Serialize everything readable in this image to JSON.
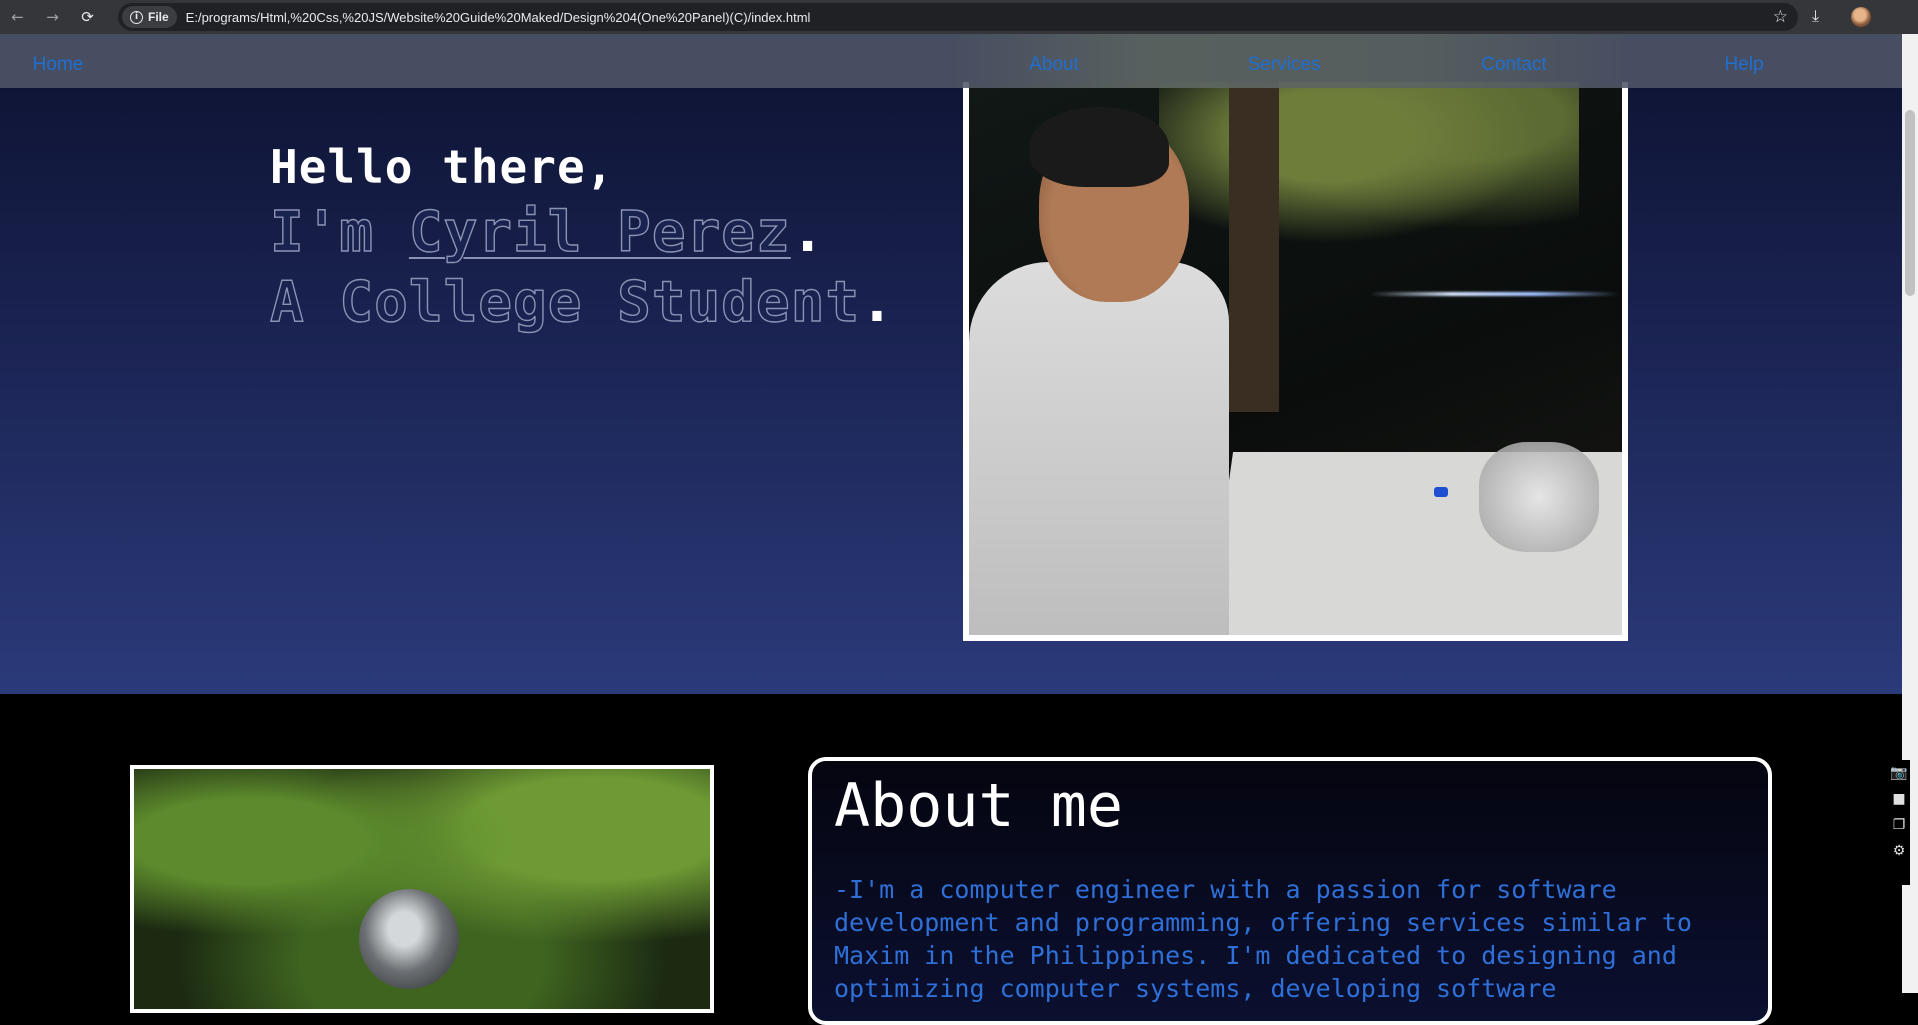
{
  "browser": {
    "back_icon": "←",
    "forward_icon": "→",
    "reload_icon": "⟳",
    "file_label": "File",
    "url": "E:/programs/Html,%20Css,%20JS/Website%20Guide%20Maked/Design%204(One%20Panel)(C)/index.html",
    "star_icon": "☆",
    "download_icon": "⤓"
  },
  "nav": {
    "home": "Home",
    "about": "About",
    "services": "Services",
    "contact": "Contact",
    "help": "Help"
  },
  "hero": {
    "greeting": "Hello there,",
    "im_prefix": "I'm ",
    "name": "Cyril Perez",
    "role": "A College Student",
    "period": "."
  },
  "about": {
    "title": "About me",
    "text": "-I'm a computer engineer with a passion for software development and programming, offering services similar to Maxim in the Philippines. I'm dedicated to designing and optimizing computer systems, developing software"
  },
  "side_widget": {
    "camera_icon": "📷",
    "video_icon": "■",
    "window_icon": "❐",
    "gear_icon": "⚙"
  },
  "colors": {
    "nav_link": "#1e6fd0",
    "about_text": "#2f6fd8",
    "hero_top": "#0d1230",
    "hero_bottom": "#2b3a7a"
  }
}
